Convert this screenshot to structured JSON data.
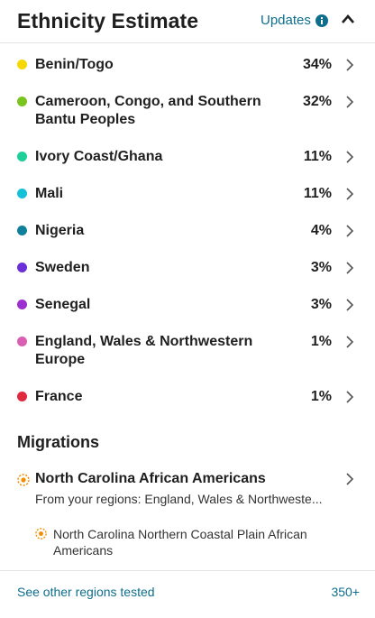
{
  "header": {
    "title": "Ethnicity Estimate",
    "updates_label": "Updates"
  },
  "regions": [
    {
      "name": "Benin/Togo",
      "percent": "34%",
      "color": "#f5d800"
    },
    {
      "name": "Cameroon, Congo, and Southern Bantu Peoples",
      "percent": "32%",
      "color": "#7ac41f"
    },
    {
      "name": "Ivory Coast/Ghana",
      "percent": "11%",
      "color": "#1fcf9a"
    },
    {
      "name": "Mali",
      "percent": "11%",
      "color": "#16c0d8"
    },
    {
      "name": "Nigeria",
      "percent": "4%",
      "color": "#0f7f9a"
    },
    {
      "name": "Sweden",
      "percent": "3%",
      "color": "#6a2fd8"
    },
    {
      "name": "Senegal",
      "percent": "3%",
      "color": "#9b2fd0"
    },
    {
      "name": "England, Wales & Northwestern Europe",
      "percent": "1%",
      "color": "#d95fb3"
    },
    {
      "name": "France",
      "percent": "1%",
      "color": "#e0283f"
    }
  ],
  "migrations": {
    "title": "Migrations",
    "items": [
      {
        "name": "North Carolina African Americans",
        "from_regions": "From your regions: England, Wales & Northweste...",
        "children": [
          "North Carolina Northern Coastal Plain African Americans"
        ]
      }
    ]
  },
  "footer": {
    "link_label": "See other regions tested",
    "count": "350+"
  },
  "colors": {
    "link": "#0f6e8d",
    "migration_icon": "#f28c00",
    "divider": "#e3e3e3"
  }
}
